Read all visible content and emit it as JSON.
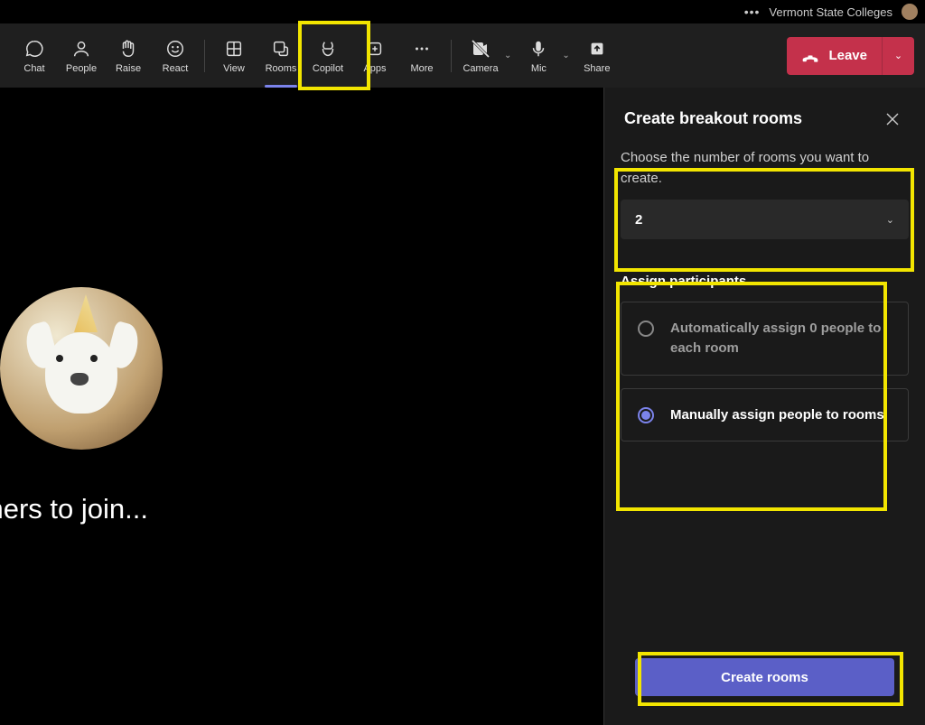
{
  "titlebar": {
    "org": "Vermont State Colleges"
  },
  "toolbar": {
    "chat": "Chat",
    "people": "People",
    "raise": "Raise",
    "react": "React",
    "view": "View",
    "rooms": "Rooms",
    "copilot": "Copilot",
    "apps": "Apps",
    "more": "More",
    "camera": "Camera",
    "mic": "Mic",
    "share": "Share",
    "leave": "Leave"
  },
  "main": {
    "waiting": "g for others to join..."
  },
  "panel": {
    "title": "Create breakout rooms",
    "choose_label": "Choose the number of rooms you want to create.",
    "room_count": "2",
    "assign_heading": "Assign participants",
    "option_auto": "Automatically assign 0 people to each room",
    "option_manual": "Manually assign people to rooms",
    "create_button": "Create rooms"
  }
}
